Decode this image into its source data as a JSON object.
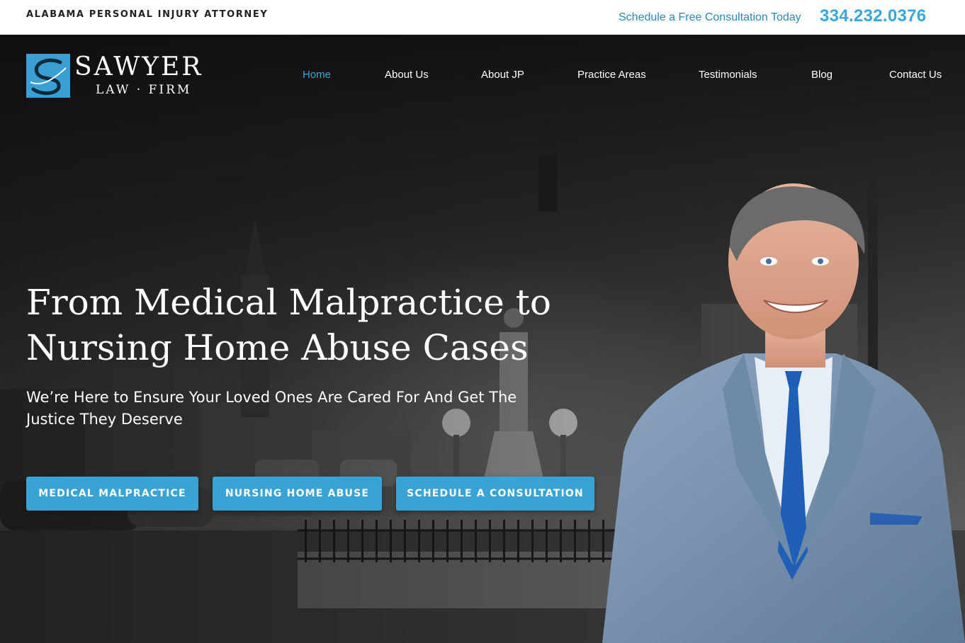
{
  "topbar": {
    "tagline": "ALABAMA PERSONAL INJURY ATTORNEY",
    "cta_text": "Schedule a Free Consultation Today",
    "phone": "334.232.0376"
  },
  "logo": {
    "name": "SAWYER",
    "sub": "LAW · FIRM"
  },
  "nav": {
    "items": [
      {
        "label": "Home",
        "active": true
      },
      {
        "label": "About Us"
      },
      {
        "label": "About JP"
      },
      {
        "label": "Practice Areas"
      },
      {
        "label": "Testimonials"
      },
      {
        "label": "Blog"
      },
      {
        "label": "Contact Us"
      }
    ]
  },
  "hero": {
    "headline_line1": "From Medical Malpractice to",
    "headline_line2": "Nursing Home Abuse Cases",
    "subhead_line1": "We’re Here to Ensure Your Loved Ones Are Cared For And Get The",
    "subhead_line2": "Justice They Deserve",
    "buttons": [
      {
        "label": "MEDICAL MALPRACTICE"
      },
      {
        "label": "NURSING HOME ABUSE"
      },
      {
        "label": "SCHEDULE A CONSULTATION"
      }
    ]
  },
  "colors": {
    "accent": "#3ba6d8",
    "button": "#3aa3d6",
    "topbar_bg": "#ffffff",
    "hero_dark": "#1a1a1a"
  }
}
